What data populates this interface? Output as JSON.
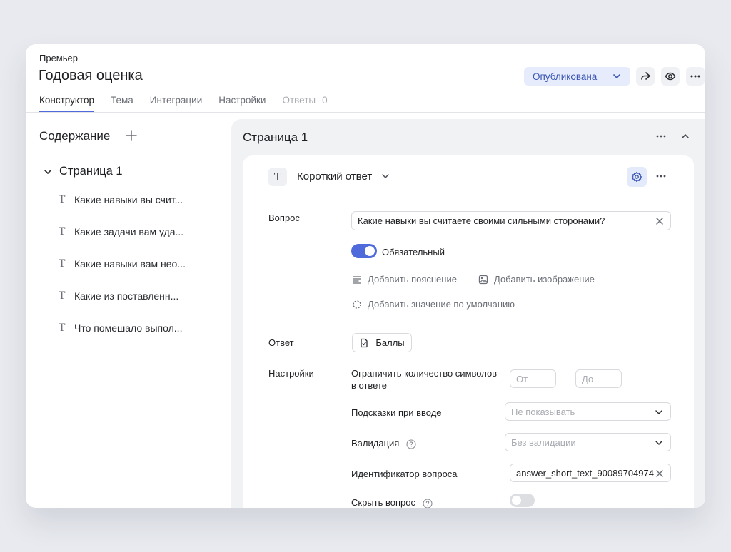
{
  "header": {
    "org": "Премьер",
    "title": "Годовая оценка",
    "tabs": [
      {
        "label": "Конструктор"
      },
      {
        "label": "Тема"
      },
      {
        "label": "Интеграции"
      },
      {
        "label": "Настройки"
      },
      {
        "label": "Ответы",
        "count": "0"
      }
    ],
    "status": "Опубликована"
  },
  "sidebar": {
    "title": "Содержание",
    "page": "Страница 1",
    "items": [
      {
        "label": "Какие навыки вы счит..."
      },
      {
        "label": "Какие задачи вам уда..."
      },
      {
        "label": "Какие навыки вам нео..."
      },
      {
        "label": "Какие из поставленн..."
      },
      {
        "label": "Что помешало выпол..."
      }
    ]
  },
  "main": {
    "page_title": "Страница 1",
    "question": {
      "type_icon": "T",
      "type_label": "Короткий ответ",
      "question_label": "Вопрос",
      "question_value": "Какие навыки вы считаете своими сильными сторонами?",
      "required_label": "Обязательный",
      "add_hint": "Добавить пояснение",
      "add_image": "Добавить изображение",
      "add_default": "Добавить значение по умолчанию",
      "answer_label": "Ответ",
      "points_button": "Баллы",
      "settings_label": "Настройки",
      "limit_label": "Ограничить количество символов в ответе",
      "limit_from": "От",
      "limit_to": "До",
      "dash": "—",
      "suggest_label": "Подсказки при вводе",
      "suggest_value": "Не показывать",
      "validation_label": "Валидация",
      "validation_value": "Без валидации",
      "id_label": "Идентификатор вопроса",
      "id_value": "answer_short_text_90089704974",
      "hide_label": "Скрыть вопрос"
    }
  },
  "colors": {
    "accent": "#4f6bdb",
    "status_bg": "#e6ecfb",
    "status_text": "#3b56b3"
  }
}
